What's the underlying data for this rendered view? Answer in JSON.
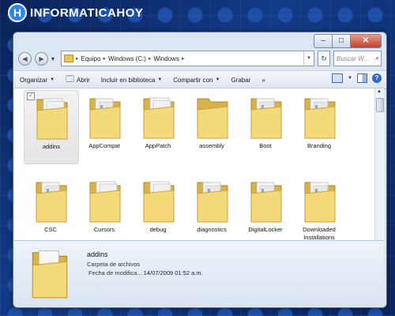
{
  "brand": {
    "badge": "H",
    "name": "INFORMATICAHOY"
  },
  "window": {
    "controls": {
      "minimize": "–",
      "maximize": "□",
      "close": "✕"
    }
  },
  "address_bar": {
    "back": "◀",
    "forward": "▶",
    "dropdown": "▾",
    "crumbs": [
      "Equipo",
      "Windows (C:)",
      "Windows"
    ],
    "separator": "▸",
    "refresh": "↻",
    "search_placeholder": "Buscar W..."
  },
  "toolbar": {
    "organize": "Organizar",
    "open": "Abrir",
    "include": "Incluir en biblioteca",
    "share": "Compartir con",
    "burn": "Grabar",
    "more": "»",
    "help": "?"
  },
  "folders": [
    {
      "name": "addins",
      "selected": true,
      "type": "papers"
    },
    {
      "name": "AppCompat",
      "type": "files"
    },
    {
      "name": "AppPatch",
      "type": "papers"
    },
    {
      "name": "assembly",
      "type": "plain"
    },
    {
      "name": "Boot",
      "type": "files"
    },
    {
      "name": "Branding",
      "type": "files"
    },
    {
      "name": "CSC",
      "type": "files"
    },
    {
      "name": "Cursors",
      "type": "papers"
    },
    {
      "name": "debug",
      "type": "papers"
    },
    {
      "name": "diagnostics",
      "type": "files"
    },
    {
      "name": "DigitalLocker",
      "type": "files"
    },
    {
      "name": "Downloaded Installations",
      "type": "files"
    }
  ],
  "details": {
    "name": "addins",
    "type": "Carpeta de archivos",
    "modified_label": "Fecha de modifica...",
    "modified_value": "14/07/2009 01:52 a.m."
  },
  "colors": {
    "folder_back": "#d9b24a",
    "folder_front": "#f4d97a",
    "window_bg": "#dde7f3"
  }
}
